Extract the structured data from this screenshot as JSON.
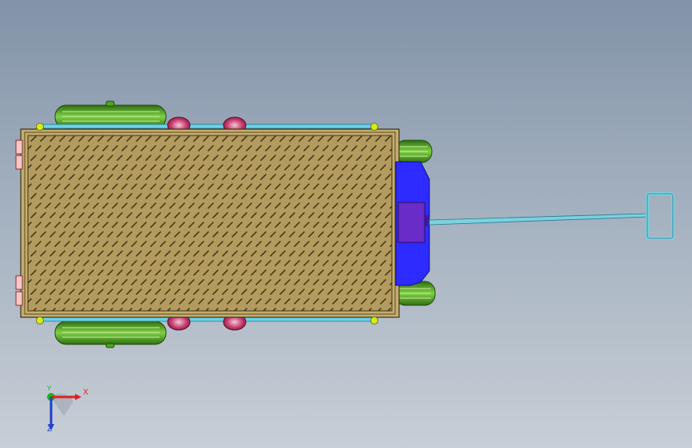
{
  "viewport": {
    "background_top": "#8293a8",
    "background_bottom": "#c7ced6"
  },
  "model": {
    "deck_color": "#b39b60",
    "deck_edge_color": "#6b5a2a",
    "tire_color": "#4aa81e",
    "tire_dark": "#2f6e12",
    "caster_color": "#c2386a",
    "rail_color": "#69d2e8",
    "front_block_color": "#2d2bff",
    "front_inner_color": "#6a2cc8",
    "handle_color": "#7ad2e0",
    "bolt_color": "#d6ec1a"
  },
  "triad": {
    "x_label": "X",
    "y_label": "Y",
    "z_label": "Z",
    "x_color": "#e02020",
    "y_color": "#20b020",
    "z_color": "#2040d0"
  }
}
